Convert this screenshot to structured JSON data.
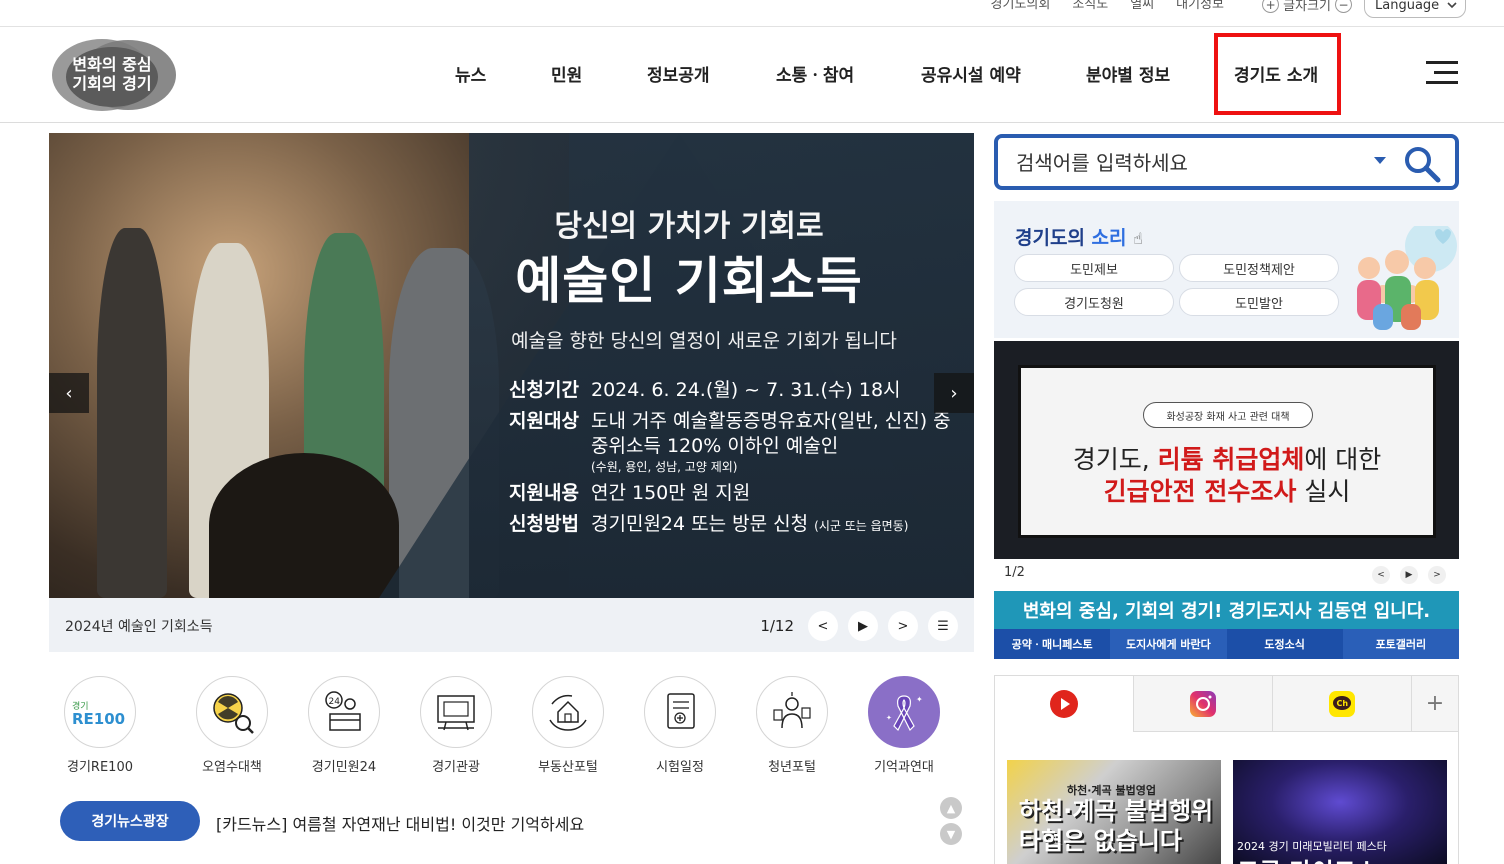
{
  "util": {
    "links": [
      "경기도의회",
      "조직도",
      "열씨",
      "대기정보"
    ],
    "font_size_label": "글자크기",
    "font_plus": "+",
    "font_minus": "−",
    "language": "Language"
  },
  "header": {
    "logo_line1": "변화의 중심",
    "logo_line2": "기회의 경기",
    "nav": [
      "뉴스",
      "민원",
      "정보공개",
      "소통ㆍ참여",
      "공유시설 예약",
      "분야별 정보",
      "경기도 소개"
    ],
    "highlight_color": "#ee1111"
  },
  "banner": {
    "title1": "당신의 가치가 기회로",
    "title2": "예술인 기회소득",
    "subtitle": "예술을 향한 당신의 열정이 새로운 기회가 됩니다",
    "rows": [
      {
        "key": "신청기간",
        "value": "2024. 6. 24.(월) ~ 7. 31.(수) 18시"
      },
      {
        "key": "지원대상",
        "value": "도내 거주 예술활동증명유효자(일반, 신진) 중",
        "value2": "중위소득 120% 이하인 예술인",
        "note": "(수원, 용인, 성남, 고양 제외)"
      },
      {
        "key": "지원내용",
        "value": "연간 150만 원 지원"
      },
      {
        "key": "신청방법",
        "value": "경기민원24 또는 방문 신청",
        "note": "(시군 또는 읍면동)"
      }
    ],
    "prev": "‹",
    "next": "›"
  },
  "caption": {
    "title": "2024년 예술인 기회소득",
    "count": "1/12",
    "prev": "<",
    "play": "▶",
    "next": ">",
    "list": "☰"
  },
  "quick_links": [
    {
      "label": "경기RE100",
      "icon": "re100-icon"
    },
    {
      "label": "오염수대책",
      "icon": "radiation-icon"
    },
    {
      "label": "경기민원24",
      "icon": "civil-desk-icon"
    },
    {
      "label": "경기관광",
      "icon": "tourism-board-icon"
    },
    {
      "label": "부동산포털",
      "icon": "house-hand-icon"
    },
    {
      "label": "시험일정",
      "icon": "exam-document-icon"
    },
    {
      "label": "청년포털",
      "icon": "youth-icon"
    },
    {
      "label": "기억과연대",
      "icon": "ribbon-icon"
    }
  ],
  "quick_re100_text": "경기",
  "quick_re100_brand": "RE100",
  "news": {
    "badge": "경기뉴스광장",
    "headline": "[카드뉴스] 여름철 자연재난 대비법! 이것만 기억하세요",
    "up": "▲",
    "down": "▼"
  },
  "search": {
    "placeholder": "검색어를 입력하세요"
  },
  "voice": {
    "title_a": "경기도의 ",
    "title_b": "소리",
    "buttons": [
      "도민제보",
      "도민정책제안",
      "경기도청원",
      "도민발안"
    ]
  },
  "notice": {
    "tag": "화성공장 화재 사고 관련 대책",
    "l1_a": "경기도, ",
    "l1_red": "리튬 취급업체",
    "l1_b": "에 대한",
    "l2_red": "긴급안전 전수조사",
    "l2_b": " 실시",
    "count": "1/2",
    "prev": "<",
    "play": "▶",
    "next": ">"
  },
  "governor": {
    "title": "변화의 중심, 기회의 경기! 경기도지사 김동연 입니다.",
    "tabs": [
      "공약ㆍ매니페스토",
      "도지사에게 바란다",
      "도정소식",
      "포토갤러리"
    ],
    "tab_colors": [
      "#1c4fa8",
      "#2a5fb8",
      "#1c4fa8",
      "#2a5fb8"
    ]
  },
  "sns": {
    "plus": "+",
    "thumb1_small": "하천·계곡 불법영업",
    "thumb1_big1": "하천·계곡 불법행위",
    "thumb1_big2": "타협은 없습니다",
    "thumb2_small": "2024 경기 미래모빌리티 페스타",
    "thumb2_big": "드론 라이트쇼"
  }
}
